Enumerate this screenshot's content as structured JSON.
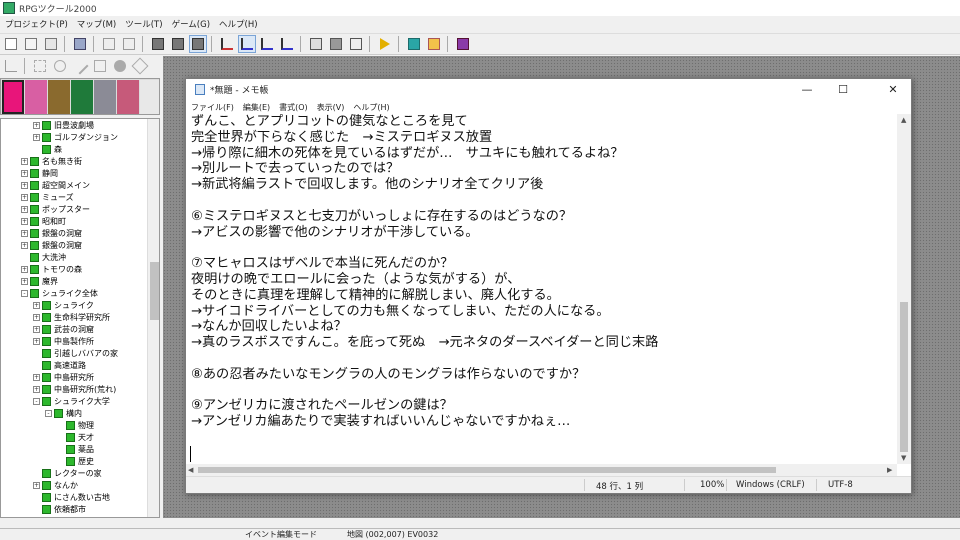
{
  "app": {
    "title": "RPGツクール2000"
  },
  "menubar": [
    "プロジェクト(P)",
    "マップ(M)",
    "ツール(T)",
    "ゲーム(G)",
    "ヘルプ(H)"
  ],
  "tree": {
    "items": [
      {
        "label": "旧豊波劇場",
        "indent": 1,
        "expander": "+"
      },
      {
        "label": "ゴルフダンジョン",
        "indent": 1,
        "expander": "+"
      },
      {
        "label": "森",
        "indent": 1,
        "expander": ""
      },
      {
        "label": "名も無き街",
        "indent": 0,
        "expander": "+"
      },
      {
        "label": "静岡",
        "indent": 0,
        "expander": "+"
      },
      {
        "label": "超空間メイン",
        "indent": 0,
        "expander": "+"
      },
      {
        "label": "ミューズ",
        "indent": 0,
        "expander": "+"
      },
      {
        "label": "ポップスター",
        "indent": 0,
        "expander": "+"
      },
      {
        "label": "昭和町",
        "indent": 0,
        "expander": "+"
      },
      {
        "label": "銀盤の洞窟",
        "indent": 0,
        "expander": "+"
      },
      {
        "label": "銀盤の洞窟",
        "indent": 0,
        "expander": "+"
      },
      {
        "label": "大洗沖",
        "indent": 0,
        "expander": ""
      },
      {
        "label": "トモワの森",
        "indent": 0,
        "expander": "+"
      },
      {
        "label": "魔界",
        "indent": 0,
        "expander": "+"
      },
      {
        "label": "シュライク全体",
        "indent": 0,
        "expander": "-"
      },
      {
        "label": "シュライク",
        "indent": 1,
        "expander": "+"
      },
      {
        "label": "生命科学研究所",
        "indent": 1,
        "expander": "+"
      },
      {
        "label": "武芸の洞窟",
        "indent": 1,
        "expander": "+"
      },
      {
        "label": "中島製作所",
        "indent": 1,
        "expander": "+"
      },
      {
        "label": "引越しババアの家",
        "indent": 1,
        "expander": ""
      },
      {
        "label": "高速道路",
        "indent": 1,
        "expander": ""
      },
      {
        "label": "中島研究所",
        "indent": 1,
        "expander": "+"
      },
      {
        "label": "中島研究所(荒れ)",
        "indent": 1,
        "expander": "+"
      },
      {
        "label": "シュライク大学",
        "indent": 1,
        "expander": "-"
      },
      {
        "label": "構内",
        "indent": 2,
        "expander": "-"
      },
      {
        "label": "物理",
        "indent": 3,
        "expander": ""
      },
      {
        "label": "天才",
        "indent": 3,
        "expander": ""
      },
      {
        "label": "薬品",
        "indent": 3,
        "expander": ""
      },
      {
        "label": "歴史",
        "indent": 3,
        "expander": ""
      },
      {
        "label": "レクターの家",
        "indent": 1,
        "expander": ""
      },
      {
        "label": "なんか",
        "indent": 1,
        "expander": "+"
      },
      {
        "label": "にさん数い古地",
        "indent": 1,
        "expander": ""
      },
      {
        "label": "依頼都市",
        "indent": 1,
        "expander": ""
      }
    ]
  },
  "notepad": {
    "title": "*無題 - メモ帳",
    "menu": [
      "ファイル(F)",
      "編集(E)",
      "書式(O)",
      "表示(V)",
      "ヘルプ(H)"
    ],
    "buttons": {
      "minimize": "—",
      "maximize": "☐",
      "close": "✕"
    },
    "lines": [
      "ずんこ、とアプリコットの健気なところを見て",
      "完全世界が下らなく感じた　→ミステロギヌス放置",
      "→帰り際に細木の死体を見ているはずだが…　サユキにも触れてるよね？",
      "→別ルートで去っていったのでは？",
      "→新武将編ラストで回収します。他のシナリオ全てクリア後",
      "",
      "⑥ミステロギヌスと七支刀がいっしょに存在するのはどうなの？",
      "→アビスの影響で他のシナリオが干渉している。",
      "",
      "⑦マヒャロスはザベルで本当に死んだのか？",
      "夜明けの晩でエロールに会った（ような気がする）が、",
      "そのときに真理を理解して精神的に解脱しまい、廃人化する。",
      "→サイコドライバーとしての力も無くなってしまい、ただの人になる。",
      "→なんか回収したいよね？",
      "→真のラスボスですんこ。を庇って死ぬ　→元ネタのダースベイダーと同じ末路",
      "",
      "⑧あの忍者みたいなモングラの人のモングラは作らないのですか？",
      "",
      "⑨アンゼリカに渡されたペールゼンの鍵は？",
      "→アンゼリカ編あたりで実装すればいいんじゃないですかねぇ…"
    ],
    "status": {
      "position": "48 行、1 列",
      "zoom": "100%",
      "line_ending": "Windows (CRLF)",
      "encoding": "UTF-8"
    }
  },
  "statusbar": {
    "mode": "イベント編集モード",
    "map": "地図 (002,007) EV0032"
  }
}
